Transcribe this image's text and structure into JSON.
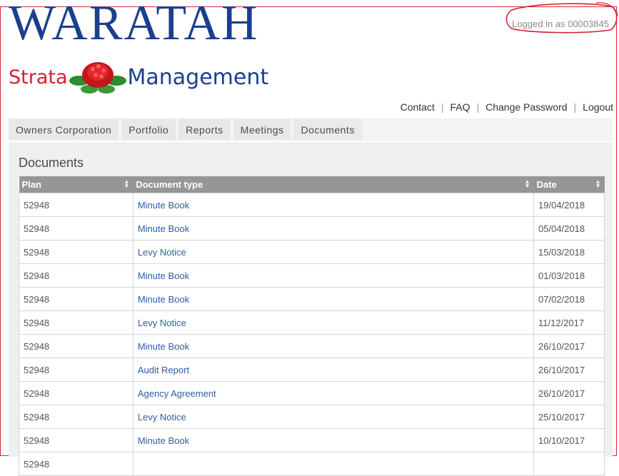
{
  "logo": {
    "title": "WARATAH",
    "sub_left": "Strata",
    "sub_right": "Management"
  },
  "header": {
    "logged_in": "Logged in as 00003845"
  },
  "top_links": [
    "Contact",
    "FAQ",
    "Change Password",
    "Logout"
  ],
  "nav": {
    "tabs": [
      "Owners Corporation",
      "Portfolio",
      "Reports",
      "Meetings",
      "Documents"
    ]
  },
  "page": {
    "title": "Documents"
  },
  "table": {
    "columns": [
      "Plan",
      "Document type",
      "Date"
    ],
    "rows": [
      [
        "52948",
        "Minute Book",
        "19/04/2018"
      ],
      [
        "52948",
        "Minute Book",
        "05/04/2018"
      ],
      [
        "52948",
        "Levy Notice",
        "15/03/2018"
      ],
      [
        "52948",
        "Minute Book",
        "01/03/2018"
      ],
      [
        "52948",
        "Minute Book",
        "07/02/2018"
      ],
      [
        "52948",
        "Levy Notice",
        "11/12/2017"
      ],
      [
        "52948",
        "Minute Book",
        "26/10/2017"
      ],
      [
        "52948",
        "Audit Report",
        "26/10/2017"
      ],
      [
        "52948",
        "Agency Agreement",
        "26/10/2017"
      ],
      [
        "52948",
        "Levy Notice",
        "25/10/2017"
      ],
      [
        "52948",
        "Minute Book",
        "10/10/2017"
      ],
      [
        "52948",
        "",
        ""
      ]
    ]
  },
  "colors": {
    "brand_blue": "#1b3f8f",
    "brand_red": "#d6202c",
    "header_gray": "#969696",
    "link_blue": "#2c5ea0"
  },
  "icons": {
    "sort": "sort-arrows-icon",
    "logo": "waratah-flower-icon"
  }
}
